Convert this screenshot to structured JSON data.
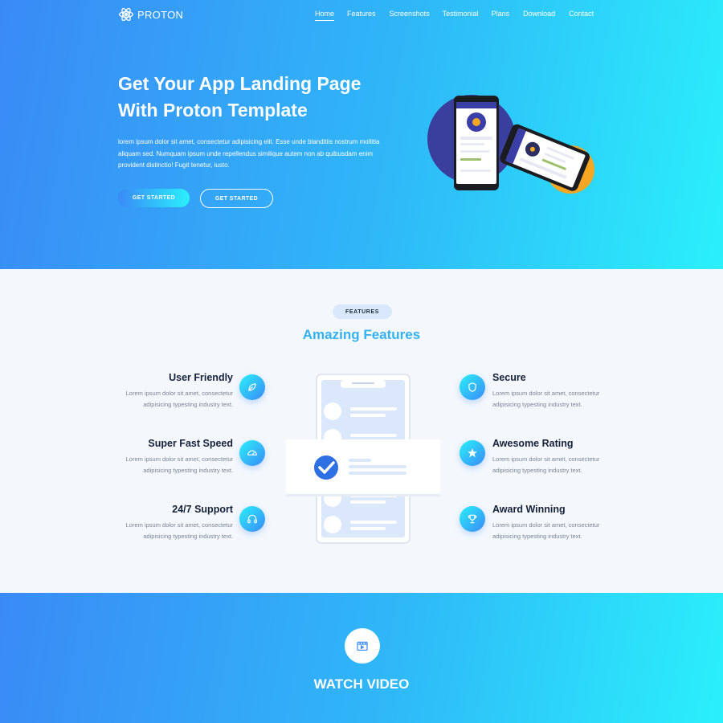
{
  "brand": {
    "name": "PROTON"
  },
  "nav": [
    {
      "label": "Home",
      "active": true
    },
    {
      "label": "Features"
    },
    {
      "label": "Screenshots"
    },
    {
      "label": "Testimonial"
    },
    {
      "label": "Plans"
    },
    {
      "label": "Download"
    },
    {
      "label": "Contact"
    }
  ],
  "hero": {
    "title_line1": "Get Your App Landing Page",
    "title_line2": "With Proton Template",
    "description": "lorem ipsum dolor sit amet, consectetur adipisicing elit. Esse unde blanditiis nostrum mollitia aliquam sed. Numquam ipsum unde repellendus similique autem non ab quibusdam enim provident distinctio! Fugit tenetur, iusto.",
    "primary_button": "GET STARTED",
    "secondary_button": "GET STARTED"
  },
  "features": {
    "pill": "FEATURES",
    "title": "Amazing Features",
    "left": [
      {
        "title": "User Friendly",
        "text_line1": "Lorem ipsum dolor sit amet, consectetur",
        "text_line2": "adipisicing typesting industry text.",
        "icon": "leaf-icon"
      },
      {
        "title": "Super Fast Speed",
        "text_line1": "Lorem ipsum dolor sit amet, consectetur",
        "text_line2": "adipisicing typesting industry text.",
        "icon": "speedometer-icon"
      },
      {
        "title": "24/7 Support",
        "text_line1": "Lorem ipsum dolor sit amet, consectetur",
        "text_line2": "adipisicing typesting industry text.",
        "icon": "headset-icon"
      }
    ],
    "right": [
      {
        "title": "Secure",
        "text_line1": "Lorem ipsum dolor sit amet, consectetur",
        "text_line2": "adipisicing typesting industry text.",
        "icon": "shield-icon"
      },
      {
        "title": "Awesome Rating",
        "text_line1": "Lorem ipsum dolor sit amet, consectetur",
        "text_line2": "adipisicing typesting industry text.",
        "icon": "star-icon"
      },
      {
        "title": "Award Winning",
        "text_line1": "Lorem ipsum dolor sit amet, consectetur",
        "text_line2": "adipisicing typesting industry text.",
        "icon": "trophy-icon"
      }
    ]
  },
  "video": {
    "title": "WATCH VIDEO",
    "icon": "video-play-icon"
  },
  "colors": {
    "gradient_start": "#3a8af6",
    "gradient_end": "#2af0fb",
    "accent_title": "#34b1ef",
    "heading_dark": "#16213a"
  }
}
